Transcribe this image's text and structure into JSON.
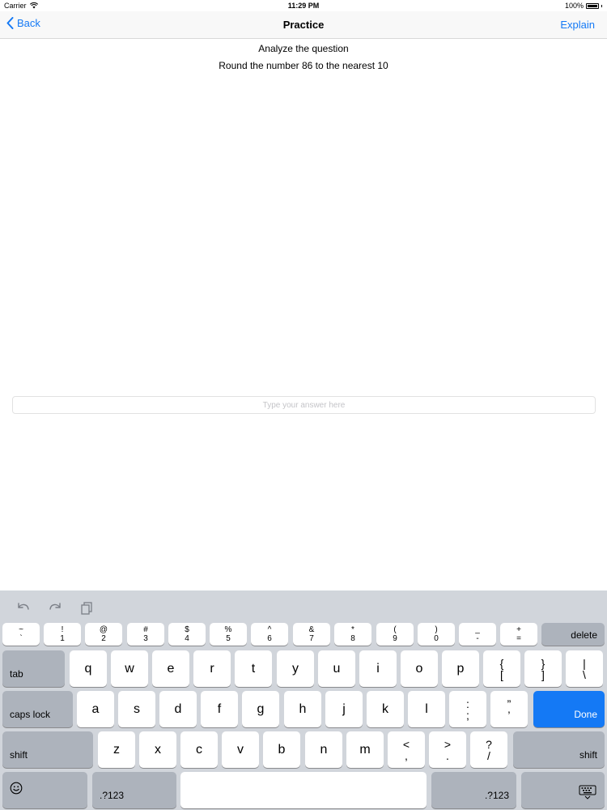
{
  "status": {
    "carrier": "Carrier",
    "time": "11:29 PM",
    "battery": "100%"
  },
  "nav": {
    "back": "Back",
    "title": "Practice",
    "explain": "Explain"
  },
  "question": {
    "prompt": "Analyze the question",
    "text": "Round the number 86 to the nearest 10"
  },
  "answer": {
    "value": "",
    "placeholder": "Type your answer here"
  },
  "keyboard": {
    "accent_color": "#1479f5",
    "toolbar": [
      "undo-icon",
      "redo-icon",
      "paste-icon"
    ],
    "number_row": [
      {
        "top": "~",
        "bottom": "`"
      },
      {
        "top": "!",
        "bottom": "1"
      },
      {
        "top": "@",
        "bottom": "2"
      },
      {
        "top": "#",
        "bottom": "3"
      },
      {
        "top": "$",
        "bottom": "4"
      },
      {
        "top": "%",
        "bottom": "5"
      },
      {
        "top": "^",
        "bottom": "6"
      },
      {
        "top": "&",
        "bottom": "7"
      },
      {
        "top": "*",
        "bottom": "8"
      },
      {
        "top": "(",
        "bottom": "9"
      },
      {
        "top": ")",
        "bottom": "0"
      },
      {
        "top": "_",
        "bottom": "-"
      },
      {
        "top": "+",
        "bottom": "="
      }
    ],
    "delete": "delete",
    "tab": "tab",
    "row1": [
      "q",
      "w",
      "e",
      "r",
      "t",
      "y",
      "u",
      "i",
      "o",
      "p"
    ],
    "row1_symbols": [
      {
        "top": "{",
        "bottom": "["
      },
      {
        "top": "}",
        "bottom": "]"
      },
      {
        "top": "|",
        "bottom": "\\"
      }
    ],
    "caps_lock": "caps lock",
    "row2": [
      "a",
      "s",
      "d",
      "f",
      "g",
      "h",
      "j",
      "k",
      "l"
    ],
    "row2_symbols": [
      {
        "top": ":",
        "bottom": ";"
      },
      {
        "top": "”",
        "bottom": "’"
      }
    ],
    "done": "Done",
    "shift": "shift",
    "row3": [
      "z",
      "x",
      "c",
      "v",
      "b",
      "n",
      "m"
    ],
    "row3_symbols": [
      {
        "top": "<",
        "bottom": ","
      },
      {
        "top": ">",
        "bottom": "."
      },
      {
        "top": "?",
        "bottom": "/"
      }
    ],
    "numbers_key": ".?123",
    "emoji_icon": "emoji-icon",
    "dismiss_icon": "keyboard-dismiss-icon"
  }
}
